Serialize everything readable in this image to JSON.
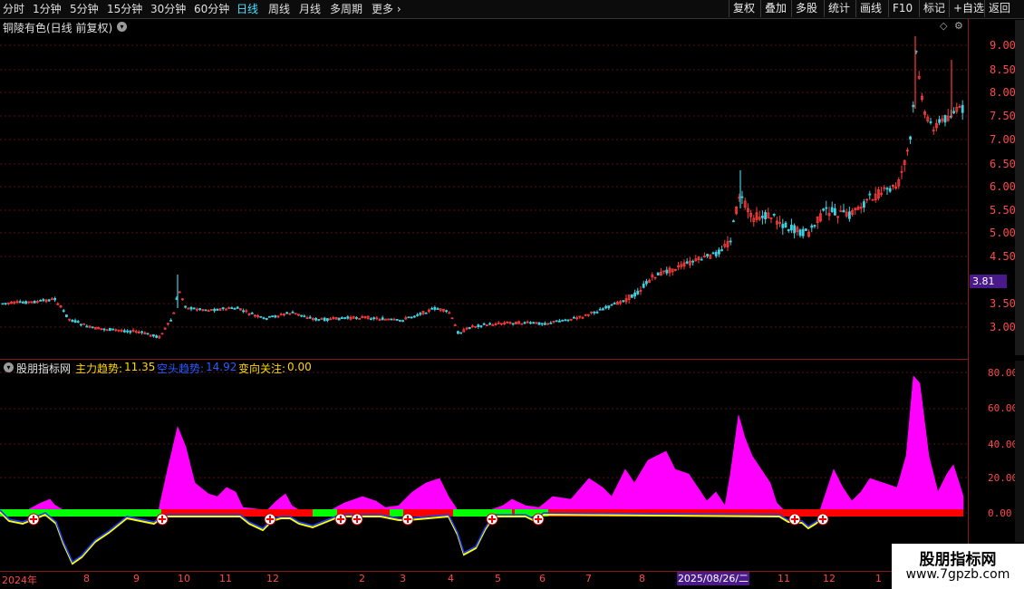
{
  "toolbar": {
    "periods": [
      "分时",
      "1分钟",
      "5分钟",
      "15分钟",
      "30分钟",
      "60分钟",
      "日线",
      "周线",
      "月线",
      "多周期",
      "更多"
    ],
    "active_period": "日线",
    "right_buttons": [
      "复权",
      "叠加",
      "多股",
      "统计",
      "画线",
      "F10",
      "标记",
      "+自选",
      "返回"
    ]
  },
  "main_chart": {
    "title": "铜陵有色(日线 前复权)",
    "y_labels": [
      "9.00",
      "8.50",
      "8.00",
      "7.50",
      "7.00",
      "6.50",
      "6.00",
      "5.50",
      "5.00",
      "4.50",
      "3.50",
      "3.00"
    ],
    "current_price_tag": "3.81"
  },
  "indicator": {
    "name": "股朋指标网",
    "main_trend_label": "主力趋势:",
    "main_trend_value": "11.35",
    "short_trend_label": "空头趋势:",
    "short_trend_value": "14.92",
    "change_label": "变向关注:",
    "change_value": "0.00",
    "y_labels": [
      "80.00",
      "60.00",
      "40.00",
      "20.00",
      "0.00"
    ]
  },
  "x_axis": {
    "labels": [
      "2024年",
      "8",
      "9",
      "10",
      "11",
      "12",
      "2",
      "3",
      "4",
      "5",
      "6",
      "7",
      "8",
      "11",
      "12",
      "1"
    ],
    "cursor_date": "2025/08/26/二"
  },
  "watermark": {
    "title": "股朋指标网",
    "url": "www.7gpzb.com"
  },
  "colors": {
    "up": "#ff3b3b",
    "down": "#3fd0e0",
    "hist": "#ff00ff",
    "bull_bar": "#00ff00",
    "bear_bar": "#ff0000",
    "line_yellow": "#ffff00",
    "line_blue": "#1a3cff",
    "axis": "#ff4a4a"
  }
}
